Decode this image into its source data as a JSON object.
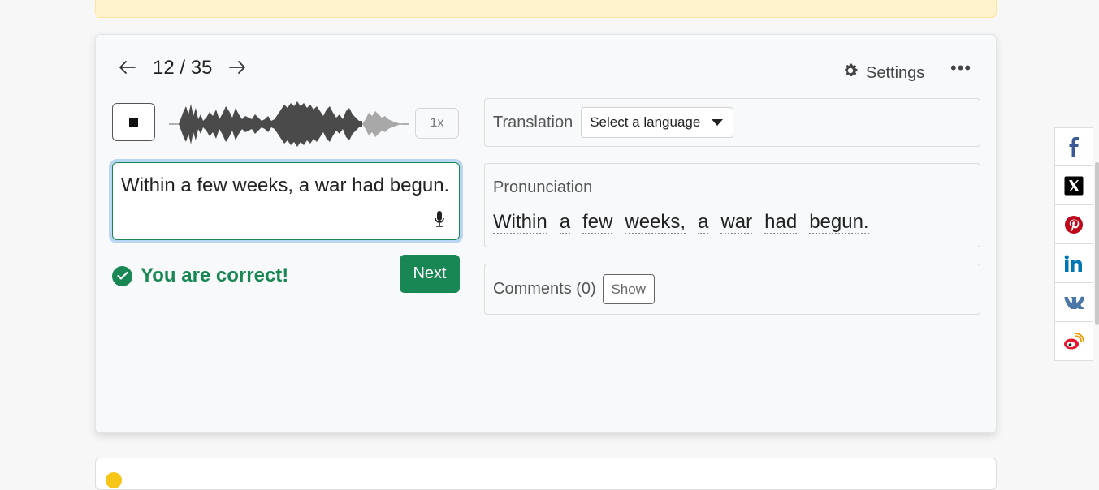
{
  "navigation": {
    "prev_icon": "arrow-left-icon",
    "next_icon": "arrow-right-icon",
    "counter": "12 / 35"
  },
  "toolbar": {
    "settings_label": "Settings",
    "settings_icon": "gear-icon",
    "more_icon": "ellipsis-icon",
    "more_label": "•••"
  },
  "player": {
    "stop_icon": "stop-icon",
    "waveform_icon": "waveform-icon",
    "speed_label": "1x"
  },
  "answer": {
    "text": "Within a few weeks, a war had begun.",
    "mic_icon": "microphone-icon"
  },
  "result": {
    "message": "You are correct!",
    "icon": "check-circle-icon",
    "color": "#198754"
  },
  "next_button": {
    "label": "Next"
  },
  "translation": {
    "label": "Translation",
    "select_value": "Select a language"
  },
  "pronunciation": {
    "label": "Pronunciation",
    "words": [
      "Within",
      "a",
      "few",
      "weeks,",
      "a",
      "war",
      "had",
      "begun."
    ]
  },
  "comments": {
    "label": "Comments (0)",
    "show_label": "Show"
  },
  "share": [
    {
      "name": "facebook-icon",
      "color": "#3b5998"
    },
    {
      "name": "x-twitter-icon",
      "color": "#000000"
    },
    {
      "name": "pinterest-icon",
      "color": "#bd081c"
    },
    {
      "name": "linkedin-icon",
      "color": "#0077b5"
    },
    {
      "name": "vk-icon",
      "color": "#4a76a8"
    },
    {
      "name": "weibo-icon",
      "color": "#e6162d"
    }
  ],
  "colors": {
    "accent_green": "#198754",
    "notice_yellow": "#fff3cd"
  }
}
